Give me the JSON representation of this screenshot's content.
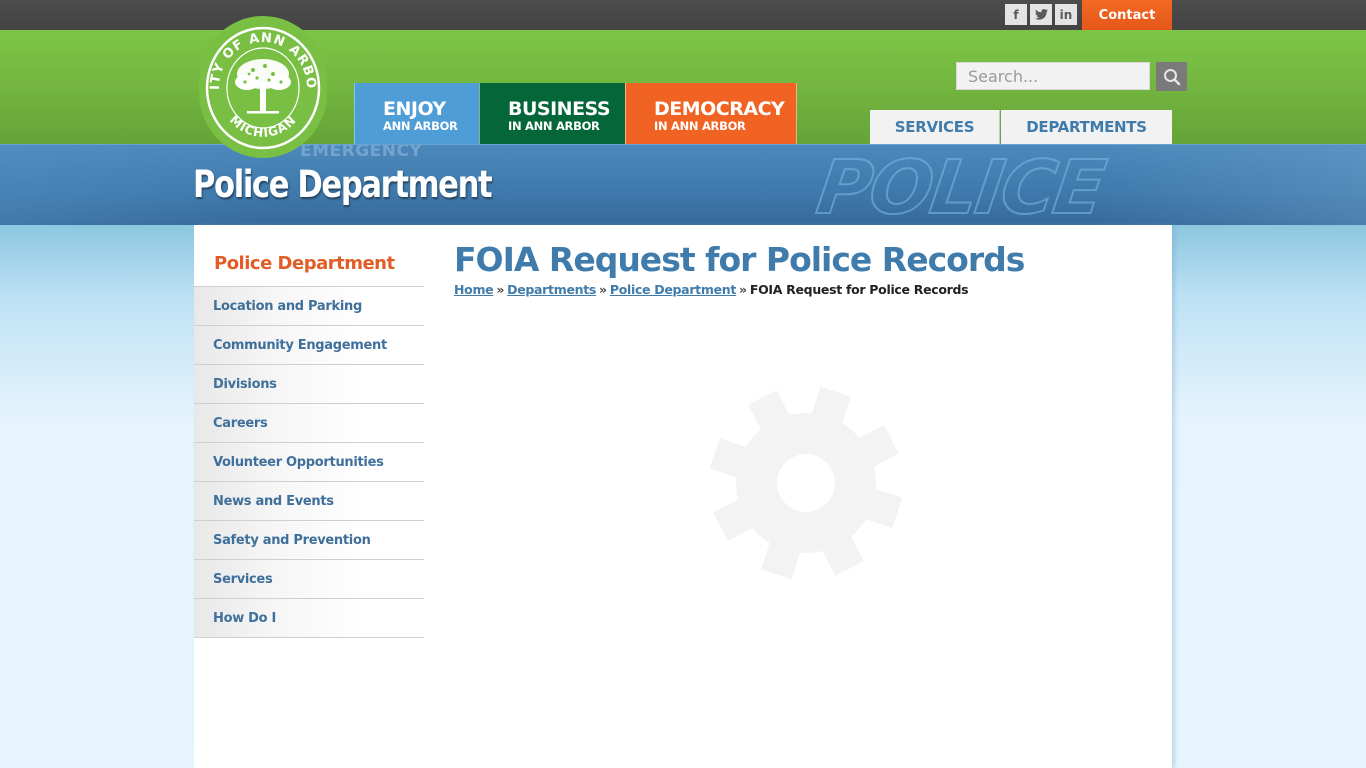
{
  "topbar": {
    "social": [
      {
        "name": "facebook",
        "glyph": "f"
      },
      {
        "name": "twitter",
        "glyph": "t"
      },
      {
        "name": "linkedin",
        "glyph": "in"
      }
    ],
    "contact_label": "Contact"
  },
  "logo": {
    "alt": "City of Ann Arbor Michigan",
    "top_text": "CITY OF ANN ARBOR",
    "bottom_text": "MICHIGAN"
  },
  "main_nav": [
    {
      "big": "ENJOY",
      "small": "ANN ARBOR",
      "color": "#4e9dd6"
    },
    {
      "big": "BUSINESS",
      "small": "IN ANN ARBOR",
      "color": "#05663a"
    },
    {
      "big": "DEMOCRACY",
      "small": "IN ANN ARBOR",
      "color": "#f06322"
    }
  ],
  "search": {
    "placeholder": "Search...",
    "value": ""
  },
  "sub_nav": {
    "services": "SERVICES",
    "departments": "DEPARTMENTS"
  },
  "banner": {
    "title": "Police Department",
    "bg_text_1": "EMERGENCY",
    "bg_text_2": "POLICE"
  },
  "sidebar": {
    "heading": "Police Department",
    "items": [
      {
        "label": "Location and Parking"
      },
      {
        "label": "Community Engagement"
      },
      {
        "label": "Divisions"
      },
      {
        "label": "Careers"
      },
      {
        "label": "Volunteer Opportunities"
      },
      {
        "label": "News and Events"
      },
      {
        "label": "Safety and Prevention"
      },
      {
        "label": "Services"
      },
      {
        "label": "How Do I"
      }
    ]
  },
  "main": {
    "title": "FOIA Request for Police Records",
    "breadcrumb": {
      "home": "Home",
      "departments": "Departments",
      "police": "Police Department",
      "current": "FOIA Request for Police Records",
      "separator": "»"
    },
    "loading_icon": "gear-icon"
  },
  "colors": {
    "green": "#7cc547",
    "orange": "#f06322",
    "link_blue": "#3f7bab",
    "heading_orange": "#e25d26",
    "dark_bar": "#4d4d4d"
  }
}
